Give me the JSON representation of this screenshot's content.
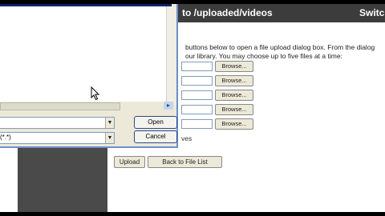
{
  "web_page": {
    "header_title": "to /uploaded/videos",
    "switch_label": "Switch",
    "instructions": [
      "buttons below to open a file upload dialog box. From the dialog",
      "our library. You may choose up to five files at a time:"
    ],
    "browse_label": "Browse...",
    "partial_text": "ves",
    "upload_label": "Upload",
    "back_label": "Back to File List"
  },
  "dialog": {
    "file_type_text": "(*.*)",
    "open_label": "Open",
    "cancel_label": "Cancel"
  },
  "icons": {
    "dropdown": "chevron-down",
    "scroll_right": "chevron-right",
    "cursor": "mouse-pointer"
  },
  "colors": {
    "web_header": "#3c3c3c",
    "left_panel": "#4a4a4a",
    "dialog_face": "#ece9d8",
    "dialog_border": "#6d8ec9"
  }
}
